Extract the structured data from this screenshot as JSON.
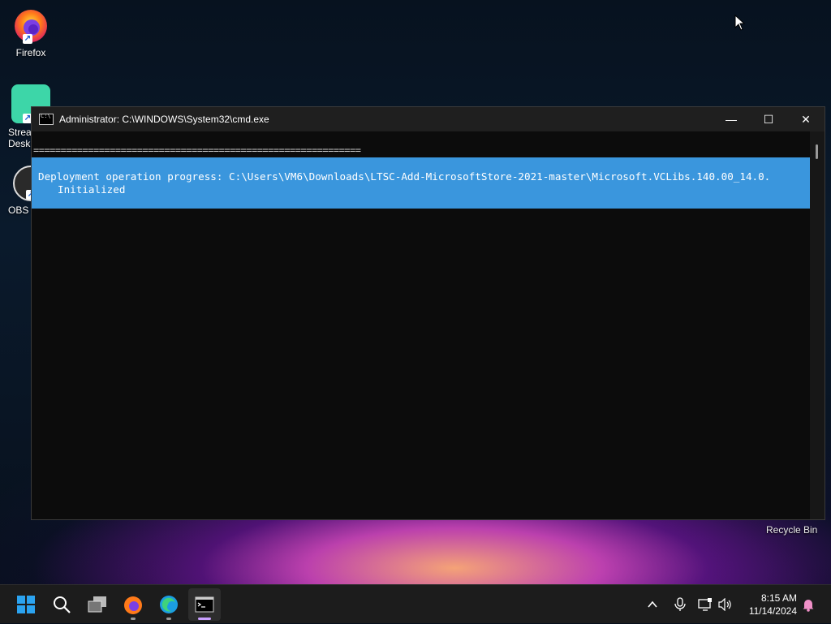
{
  "desktop": {
    "icons": [
      {
        "label": "Firefox"
      },
      {
        "label": "Strea\nDesk"
      },
      {
        "label": "OBS S"
      }
    ],
    "recycle_bin_label": "Recycle Bin"
  },
  "cmd_window": {
    "title": "Administrator: C:\\WINDOWS\\System32\\cmd.exe",
    "separator": "============================================================",
    "progress_line1": "Deployment operation progress: C:\\Users\\VM6\\Downloads\\LTSC-Add-MicrosoftStore-2021-master\\Microsoft.VCLibs.140.00_14.0.",
    "progress_line2": "Initialized",
    "minimize_glyph": "—",
    "maximize_glyph": "☐",
    "close_glyph": "✕",
    "highlight_color": "#3a96dd"
  },
  "taskbar": {
    "apps": [
      "start-icon",
      "search-icon",
      "task-view-icon",
      "firefox-icon",
      "edge-icon",
      "terminal-icon"
    ],
    "tray_chevron": "^",
    "time": "8:15 AM",
    "date": "11/14/2024"
  }
}
